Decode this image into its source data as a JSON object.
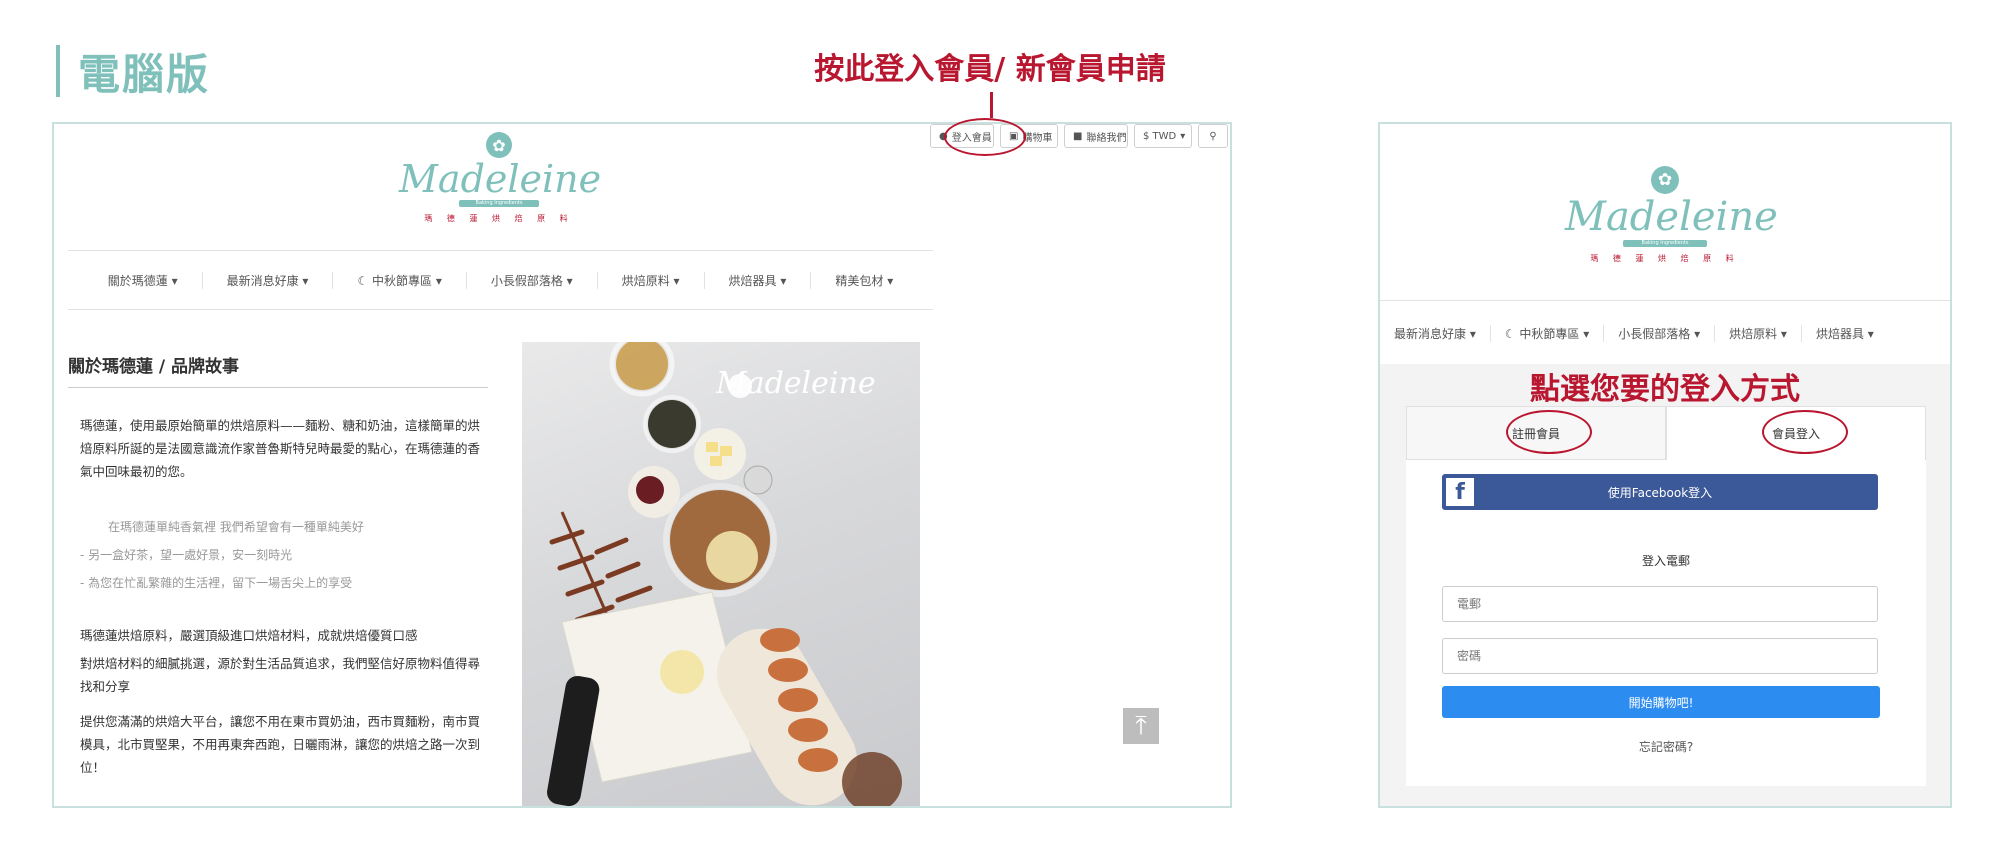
{
  "headings": {
    "desktop_title": "電腦版",
    "desktop_callout": "按此登入會員/ 新會員申請",
    "mobile_callout": "點選您要的登入方式"
  },
  "desktop": {
    "topbar": [
      {
        "icon": "user-icon",
        "label": "登入會員"
      },
      {
        "icon": "cart-icon",
        "label": "購物車"
      },
      {
        "icon": "chat-icon",
        "label": "聯絡我們"
      },
      {
        "icon": "chevron-down-icon",
        "label": "$ TWD"
      },
      {
        "icon": "search-icon",
        "label": ""
      }
    ],
    "logo": {
      "word": "Madeleine",
      "ribbon": "Baking Ingredients",
      "sub": "瑪 德 蓮 烘 焙 原 料"
    },
    "nav": [
      "關於瑪德蓮 ▾",
      "最新消息好康 ▾",
      "☾ 中秋節專區 ▾",
      "小長假部落格 ▾",
      "烘焙原料 ▾",
      "烘焙器具 ▾",
      "精美包材 ▾"
    ],
    "story": {
      "title": "關於瑪德蓮 / 品牌故事",
      "para1": "瑪德蓮，使用最原始簡單的烘焙原料——麵粉、糖和奶油，這樣簡單的烘焙原料所誕的是法國意識流作家普魯斯特兒時最愛的點心，在瑪德蓮的香氣中回味最初的您。",
      "bullet1": "在瑪德蓮單純香氣裡 我們希望會有一種單純美好",
      "bullet2": "-    另一盒好茶，望一處好景，安一刻時光",
      "bullet3": "-    為您在忙亂繁雜的生活裡，留下一場舌尖上的享受",
      "para2": "瑪德蓮烘焙原料，嚴選頂級進口烘焙材料，成就烘焙優質口感",
      "para3": "對烘焙材料的細膩挑選，源於對生活品質追求，我們堅信好原物料值得尋找和分享",
      "para4": "提供您滿滿的烘焙大平台，讓您不用在東市買奶油，西市買麵粉，南市買模具，北市買堅果，不用再東奔西跑，日曬雨淋，讓您的烘焙之路一次到位！"
    },
    "photo_watermark": "Madeleine",
    "back_to_top": "⤒"
  },
  "mobile": {
    "logo": {
      "word": "Madeleine",
      "ribbon": "Baking Ingredients",
      "sub": "瑪 德 蓮 烘 焙 原 料"
    },
    "nav": [
      "最新消息好康 ▾",
      "☾ 中秋節專區 ▾",
      "小長假部落格 ▾",
      "烘焙原料 ▾",
      "烘焙器具 ▾"
    ],
    "tabs": [
      "註冊會員",
      "會員登入"
    ],
    "facebook_label": "使用Facebook登入",
    "login_label": "登入電郵",
    "email_placeholder": "電郵",
    "password_placeholder": "密碼",
    "submit_label": "開始購物吧!",
    "forgot_label": "忘記密碼?"
  },
  "colors": {
    "accent": "#7fc0bb",
    "callout": "#b9162f",
    "facebook": "#3b5998",
    "submit": "#2d8cf0"
  }
}
